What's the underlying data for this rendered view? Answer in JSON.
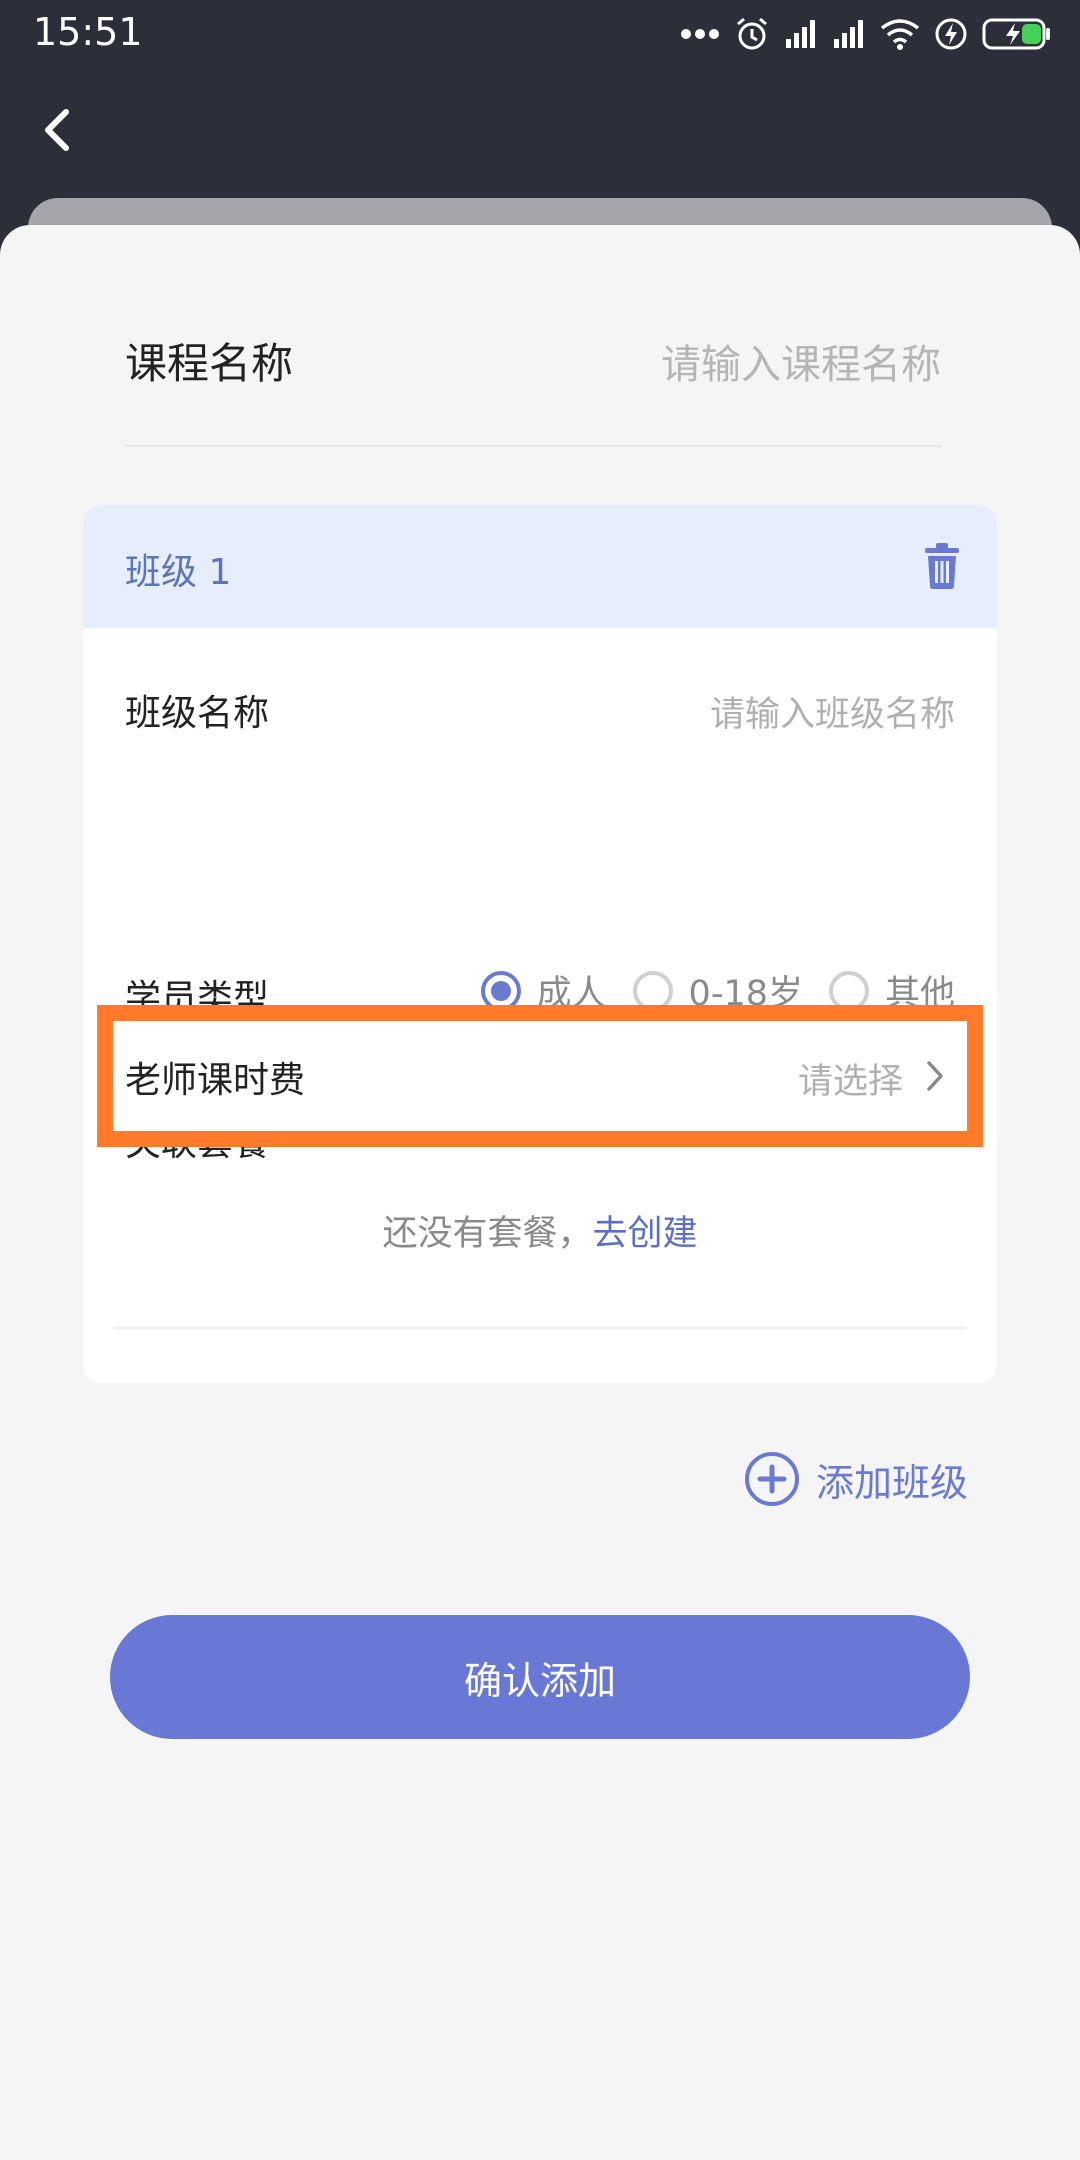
{
  "status_bar": {
    "time": "15:51",
    "icons": [
      "more-dots-icon",
      "alarm-icon",
      "signal-icon",
      "signal-icon",
      "wifi-icon",
      "charging-icon",
      "battery-icon"
    ]
  },
  "colors": {
    "accent": "#6878d4",
    "highlight_border": "#ff7a2a",
    "header_bg": "#2c2f3a",
    "card_head_bg": "#e7eefb"
  },
  "form": {
    "course_name_label": "课程名称",
    "course_name_placeholder": "请输入课程名称"
  },
  "class_card": {
    "title": "班级 1",
    "class_name_label": "班级名称",
    "class_name_placeholder": "请输入班级名称",
    "teacher_fee_label": "老师课时费",
    "teacher_fee_value": "请选择",
    "student_type_label": "学员类型",
    "student_type_options": [
      "成人",
      "0-18岁",
      "其他"
    ],
    "student_type_selected": "成人",
    "package_label": "关联套餐",
    "package_empty_text": "还没有套餐，",
    "package_create_link": "去创建"
  },
  "actions": {
    "add_class": "添加班级",
    "confirm": "确认添加"
  }
}
